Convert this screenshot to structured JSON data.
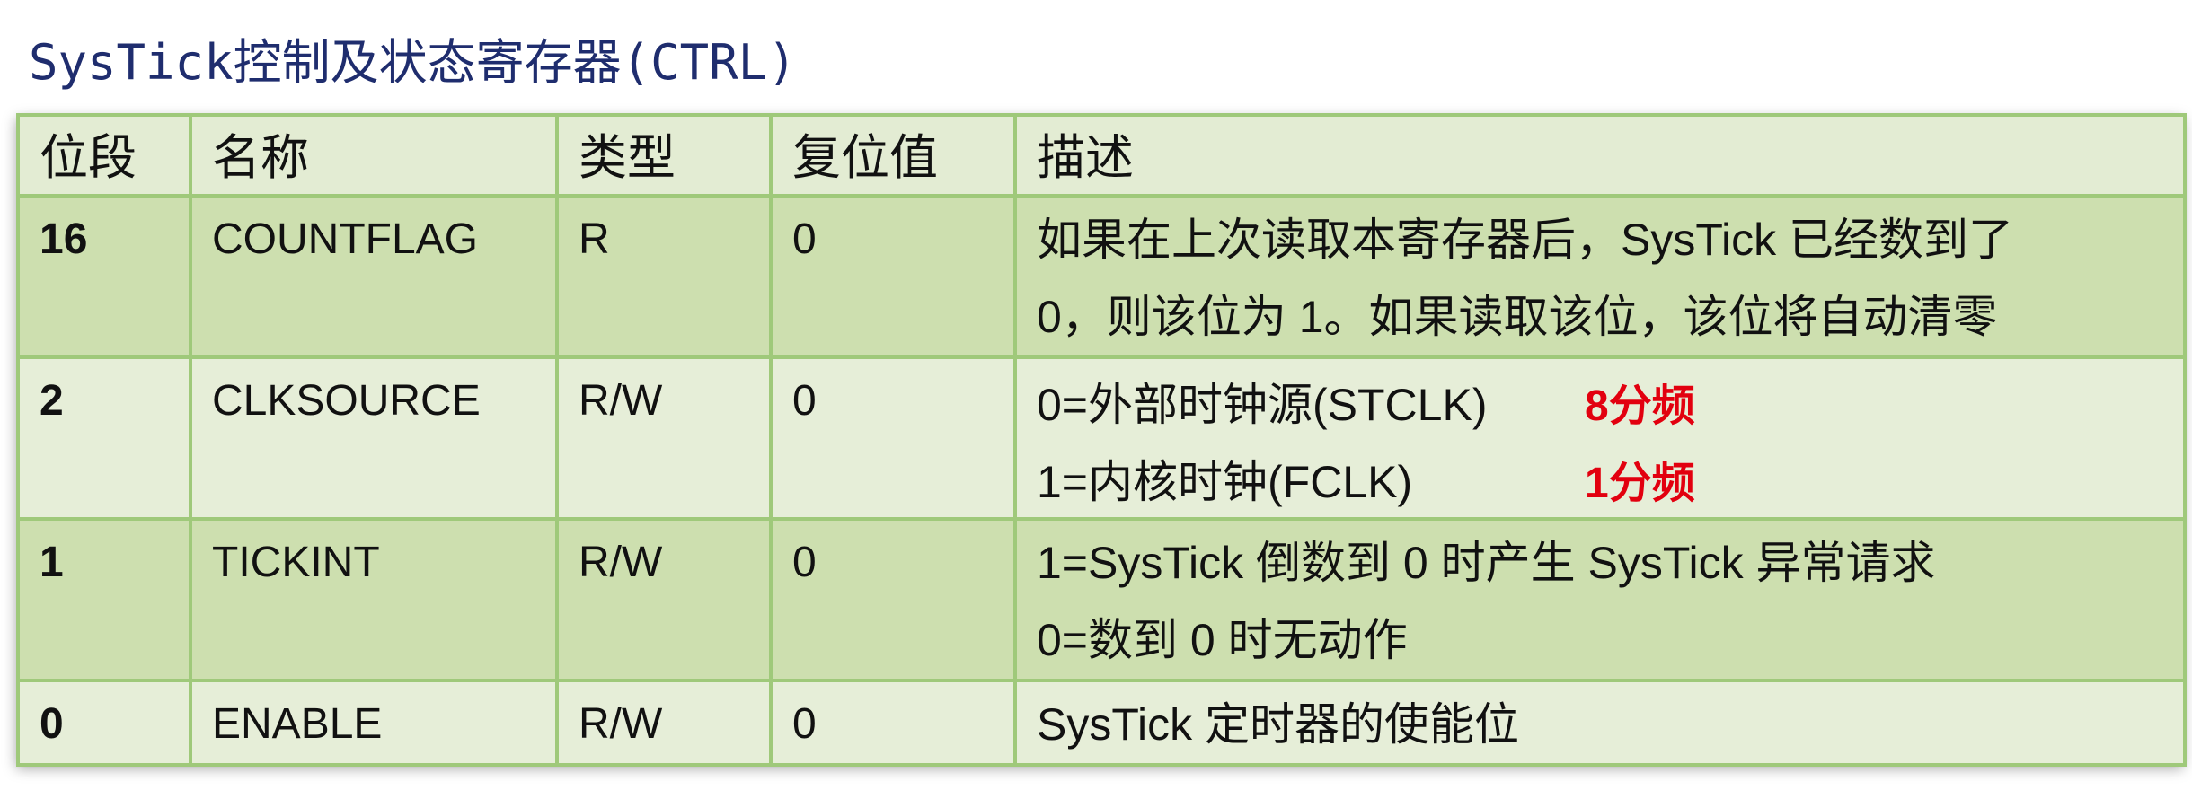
{
  "title": "SysTick控制及状态寄存器(CTRL)",
  "headers": [
    "位段",
    "名称",
    "类型",
    "复位值",
    "描述"
  ],
  "rows": [
    {
      "bit": "16",
      "name": "COUNTFLAG",
      "type": "R",
      "reset": "0",
      "desc": [
        "如果在上次读取本寄存器后，SysTick 已经数到了",
        "0，则该位为 1。如果读取该位，该位将自动清零"
      ]
    },
    {
      "bit": "2",
      "name": "CLKSOURCE",
      "type": "R/W",
      "reset": "0",
      "desc": [
        "0=外部时钟源(STCLK)",
        "1=内核时钟(FCLK)"
      ],
      "notes": [
        "8分频",
        "1分频"
      ]
    },
    {
      "bit": "1",
      "name": "TICKINT",
      "type": "R/W",
      "reset": "0",
      "desc": [
        "1=SysTick 倒数到 0 时产生 SysTick 异常请求",
        "0=数到 0 时无动作"
      ]
    },
    {
      "bit": "0",
      "name": "ENABLE",
      "type": "R/W",
      "reset": "0",
      "desc": [
        "SysTick 定时器的使能位"
      ]
    }
  ],
  "colors": {
    "title": "#1f2d6e",
    "header_bg": "#e3ecd3",
    "row_dark": "#cddfaf",
    "row_light": "#e6eed8",
    "border": "#9fc97a",
    "note_red": "#e2000f"
  }
}
